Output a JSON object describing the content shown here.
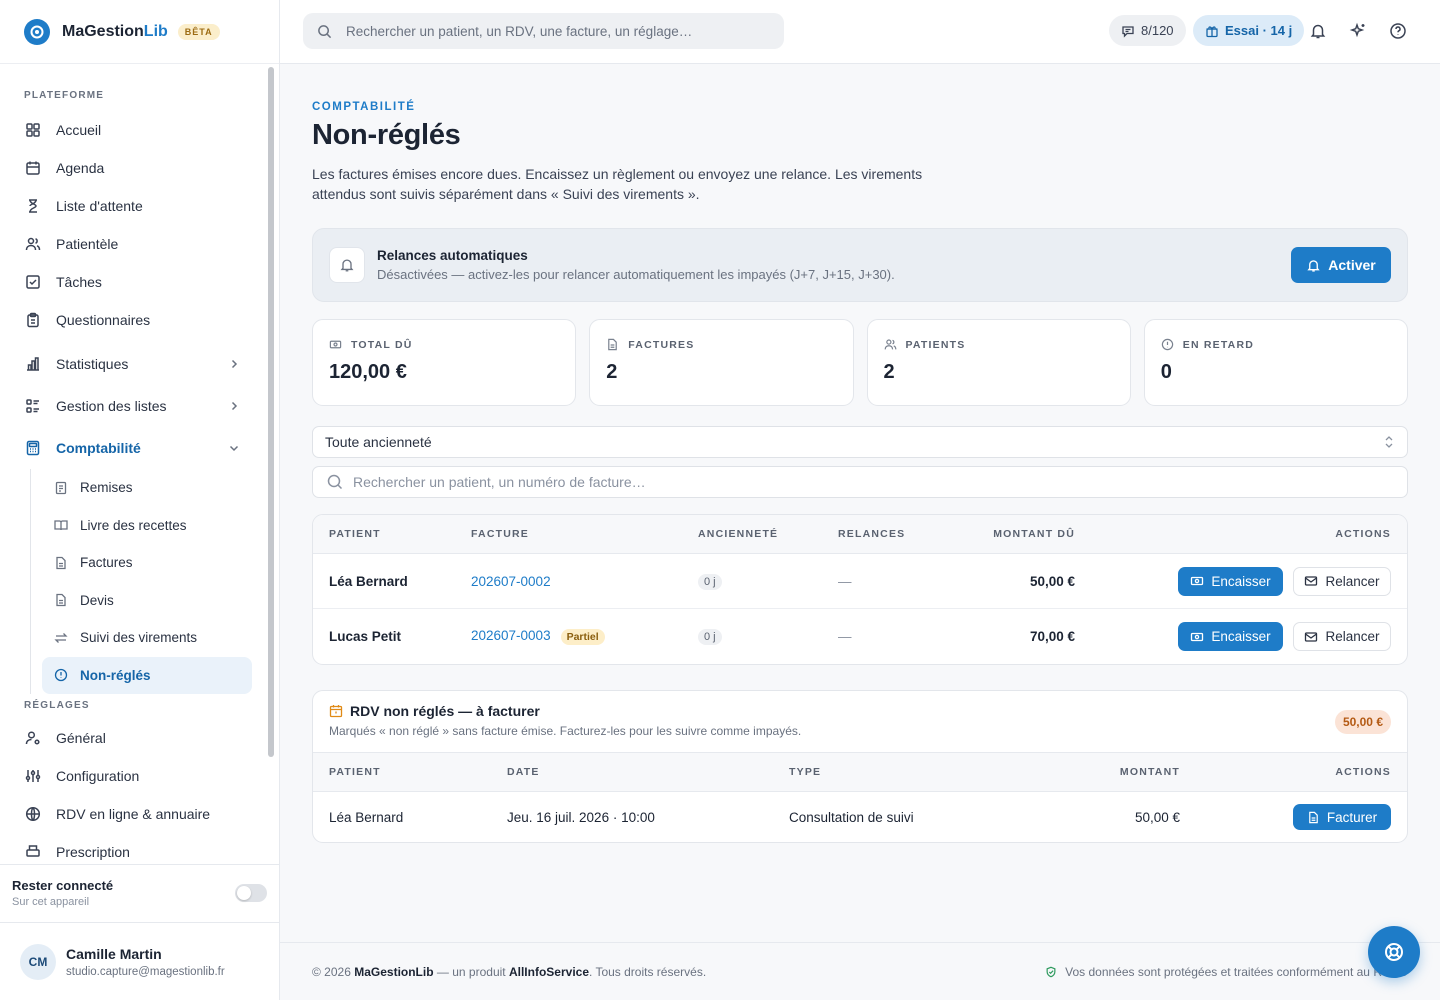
{
  "brand": {
    "name_a": "MaGestion",
    "name_b": "Lib",
    "beta": "BÊTA"
  },
  "nav": {
    "platform_label": "PLATEFORME",
    "accueil": "Accueil",
    "agenda": "Agenda",
    "attente": "Liste d'attente",
    "patientele": "Patientèle",
    "taches": "Tâches",
    "questionnaires": "Questionnaires",
    "statistiques": "Statistiques",
    "listes": "Gestion des listes",
    "comptabilite": "Comptabilité",
    "remises": "Remises",
    "livre": "Livre des recettes",
    "factures": "Factures",
    "devis": "Devis",
    "virements": "Suivi des virements",
    "nonregles": "Non-réglés",
    "settings_label": "RÉGLAGES",
    "general": "Général",
    "configuration": "Configuration",
    "rdv_ligne": "RDV en ligne & annuaire",
    "prescription": "Prescription"
  },
  "stay": {
    "title": "Rester connecté",
    "sub": "Sur cet appareil"
  },
  "user": {
    "initials": "CM",
    "name": "Camille Martin",
    "email": "studio.capture@magestionlib.fr"
  },
  "topbar": {
    "search_placeholder": "Rechercher un patient, un RDV, une facture, un réglage…",
    "quota": "8/120",
    "trial": "Essai · 14 j"
  },
  "page": {
    "eyebrow": "COMPTABILITÉ",
    "title": "Non-réglés",
    "description": "Les factures émises encore dues. Encaissez un règlement ou envoyez une relance. Les virements attendus sont suivis séparément dans « Suivi des virements ».",
    "auto_title": "Relances automatiques",
    "auto_sub": "Désactivées — activez-les pour relancer automatiquement les impayés (J+7, J+15, J+30).",
    "auto_btn": "Activer"
  },
  "stats": {
    "total_label": "TOTAL DÛ",
    "total_value": "120,00 €",
    "factures_label": "FACTURES",
    "factures_value": "2",
    "patients_label": "PATIENTS",
    "patients_value": "2",
    "retard_label": "EN RETARD",
    "retard_value": "0"
  },
  "filters": {
    "age_selected": "Toute ancienneté",
    "search_placeholder": "Rechercher un patient, un numéro de facture…"
  },
  "table": {
    "headers": {
      "patient": "PATIENT",
      "facture": "FACTURE",
      "anciennete": "ANCIENNETÉ",
      "relances": "RELANCES",
      "montant": "MONTANT DÛ",
      "actions": "ACTIONS"
    },
    "rows": [
      {
        "patient": "Léa Bernard",
        "facture": "202607-0002",
        "badge": "",
        "age": "0 j",
        "relances": "—",
        "montant": "50,00 €"
      },
      {
        "patient": "Lucas Petit",
        "facture": "202607-0003",
        "badge": "Partiel",
        "age": "0 j",
        "relances": "—",
        "montant": "70,00 €"
      }
    ],
    "encaisser": "Encaisser",
    "relancer": "Relancer"
  },
  "rdv": {
    "title": "RDV non réglés — à facturer",
    "subtitle": "Marqués « non réglé » sans facture émise. Facturez-les pour les suivre comme impayés.",
    "total": "50,00 €",
    "headers": {
      "patient": "PATIENT",
      "date": "DATE",
      "type": "TYPE",
      "montant": "MONTANT",
      "actions": "ACTIONS"
    },
    "rows": [
      {
        "patient": "Léa Bernard",
        "date": "Jeu. 16 juil. 2026 · 10:00",
        "type": "Consultation de suivi",
        "montant": "50,00 €"
      }
    ],
    "facturer": "Facturer"
  },
  "footer": {
    "copy": "© 2026",
    "brand": "MaGestionLib",
    "mid": "— un produit",
    "company": "AllInfoService",
    "end": ". Tous droits réservés.",
    "right": "Vos données sont protégées et traitées conformément au RGPD"
  },
  "colors": {
    "accent": "#1e7cc8",
    "partial_badge": "#fdeec8",
    "rdv_total_badge": "#fbe3d6"
  }
}
